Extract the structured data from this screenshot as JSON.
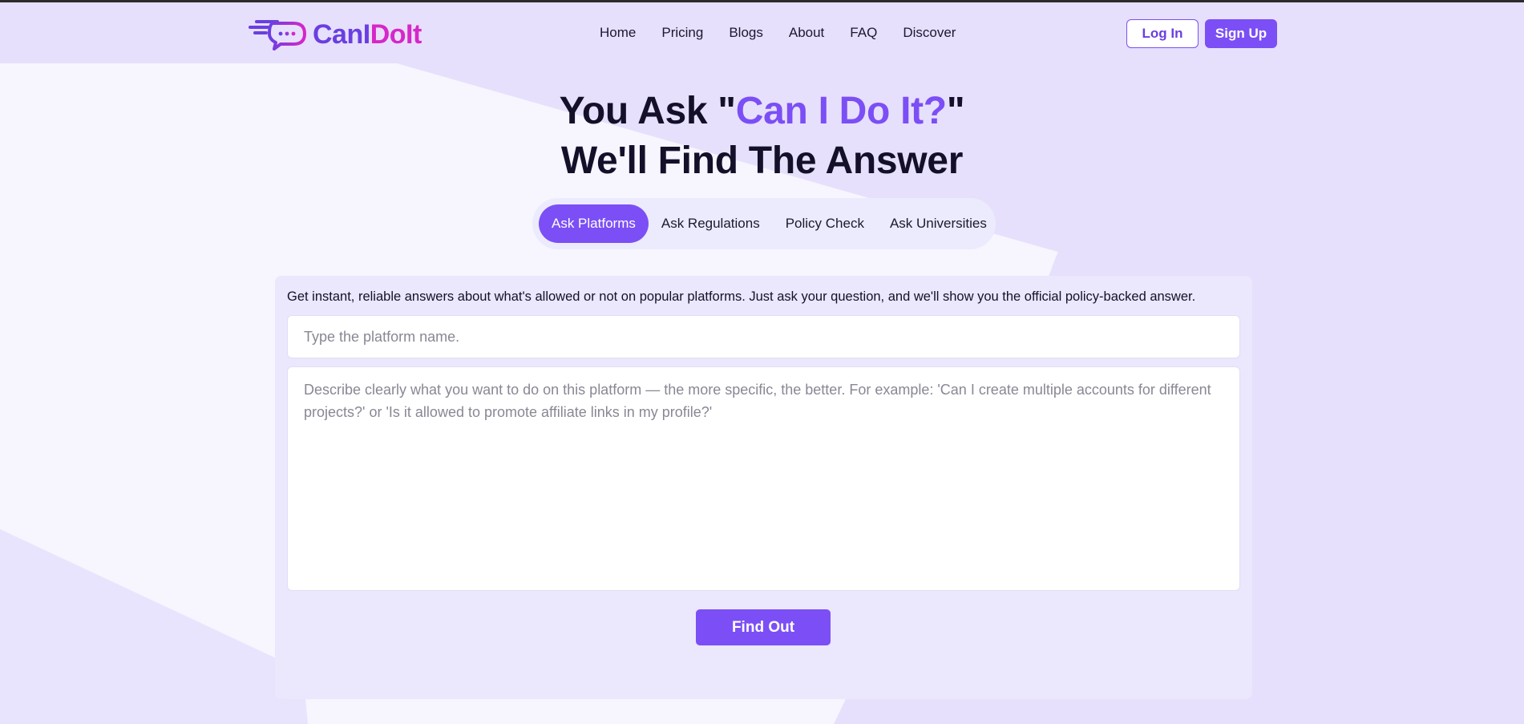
{
  "brand": {
    "name_part1": "CanI",
    "name_part2": "DoIt",
    "primary_color": "#7b4ff5",
    "secondary_color": "#d627c8",
    "logo_icon": "chat-bubble-icon"
  },
  "nav": {
    "items": [
      {
        "label": "Home"
      },
      {
        "label": "Pricing"
      },
      {
        "label": "Blogs"
      },
      {
        "label": "About"
      },
      {
        "label": "FAQ"
      },
      {
        "label": "Discover"
      }
    ],
    "login_label": "Log In",
    "signup_label": "Sign Up"
  },
  "hero": {
    "line1_prefix": "You Ask \"",
    "line1_accent": "Can I Do It?",
    "line1_suffix": "\"",
    "line2": "We'll Find The Answer"
  },
  "tabs": [
    {
      "label": "Ask Platforms",
      "active": true
    },
    {
      "label": "Ask Regulations",
      "active": false
    },
    {
      "label": "Policy Check",
      "active": false
    },
    {
      "label": "Ask Universities",
      "active": false
    }
  ],
  "form": {
    "intro": "Get instant, reliable answers about what's allowed or not on popular platforms. Just ask your question, and we'll show you the official policy-backed answer.",
    "platform_placeholder": "Type the platform name.",
    "platform_value": "",
    "description_placeholder": "Describe clearly what you want to do on this platform — the more specific, the better. For example: 'Can I create multiple accounts for different projects?' or 'Is it allowed to promote affiliate links in my profile?'",
    "description_value": "",
    "submit_label": "Find Out"
  }
}
